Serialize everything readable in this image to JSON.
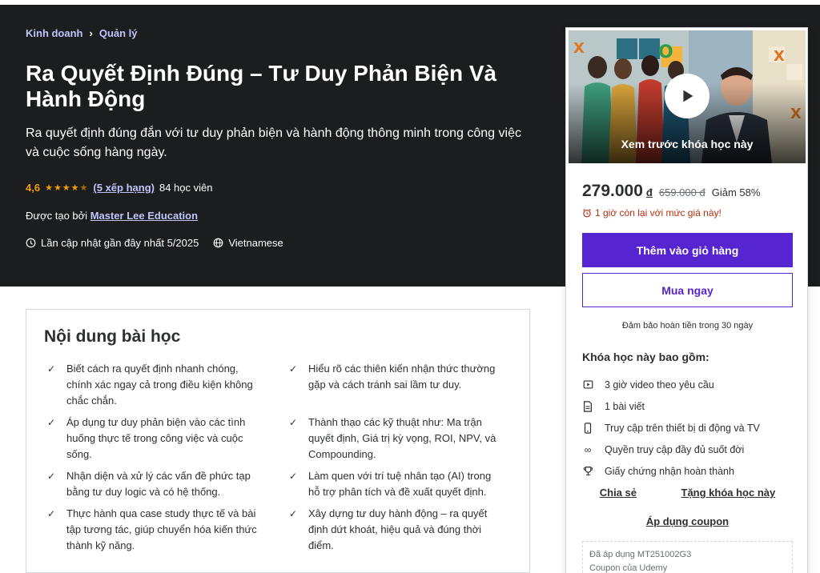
{
  "breadcrumb": [
    "Kinh doanh",
    "Quản lý"
  ],
  "course": {
    "title": "Ra Quyết Định Đúng – Tư Duy Phản Biện Và Hành Động",
    "subtitle": "Ra quyết định đúng đắn với tư duy phản biện và hành động thông minh trong công việc và cuộc sống hàng ngày.",
    "rating": "4,6",
    "rating_stars": 4.5,
    "rating_count": "(5 xếp hạng)",
    "students": "84 học viên",
    "created_prefix": "Được tạo bởi",
    "author": "Master Lee Education",
    "updated": "Lần cập nhật gần đây nhất 5/2025",
    "language": "Vietnamese"
  },
  "learn": {
    "title": "Nội dung bài học",
    "left": [
      "Biết cách ra quyết định nhanh chóng, chính xác ngay cả trong điều kiện không chắc chắn.",
      "Áp dụng tư duy phản biện vào các tình huống thực tế trong công việc và cuộc sống.",
      "Nhận diện và xử lý các vấn đề phức tạp bằng tư duy logic và có hệ thống.",
      "Thực hành qua case study thực tế và bài tập tương tác, giúp chuyển hóa kiến thức thành kỹ năng."
    ],
    "right": [
      "Hiểu rõ các thiên kiến nhận thức thường gặp và cách tránh sai lầm tư duy.",
      "Thành thạo các kỹ thuật như: Ma trận quyết định, Giá trị kỳ vọng, ROI, NPV, và Compounding.",
      "Làm quen với trí tuệ nhân tạo (AI) trong hỗ trợ phân tích và đề xuất quyết định.",
      "Xây dựng tư duy hành động – ra quyết định dứt khoát, hiệu quả và đúng thời điểm."
    ]
  },
  "sidebar": {
    "preview_label": "Xem trước khóa học này",
    "price": "279.000",
    "currency": "đ",
    "old_price": "659.000 đ",
    "discount": "Giảm 58%",
    "urgency": "1 giờ còn lại với mức giá này!",
    "add_to_cart": "Thêm vào giỏ hàng",
    "buy_now": "Mua ngay",
    "guarantee": "Đảm bảo hoàn tiền trong 30 ngày",
    "includes_title": "Khóa học này bao gồm:",
    "includes": [
      {
        "icon": "video-icon",
        "label": "3 giờ video theo yêu cầu"
      },
      {
        "icon": "article-icon",
        "label": "1 bài viết"
      },
      {
        "icon": "mobile-icon",
        "label": "Truy cập trên thiết bị di động và TV"
      },
      {
        "icon": "infinity-icon",
        "label": "Quyền truy cập đầy đủ suốt đời"
      },
      {
        "icon": "trophy-icon",
        "label": "Giấy chứng nhận hoàn thành"
      }
    ],
    "share": "Chia sẻ",
    "gift": "Tặng khóa học này",
    "apply_coupon": "Áp dụng coupon",
    "coupon_applied": "Đã áp dụng MT251002G3",
    "coupon_source": "Coupon của Udemy"
  },
  "colors": {
    "hero_bg": "#1c1d1f",
    "brand_purple": "#5624d0",
    "link_lilac": "#c0c4fc",
    "star_orange": "#f69c08",
    "urgent_red": "#b32d0f"
  }
}
